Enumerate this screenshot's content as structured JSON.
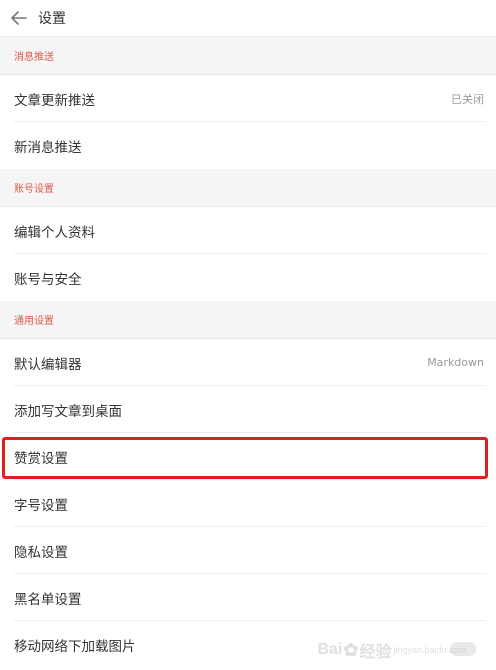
{
  "header": {
    "title": "设置"
  },
  "sections": [
    {
      "heading": "消息推送",
      "items": [
        {
          "label": "文章更新推送",
          "value": "已关闭"
        },
        {
          "label": "新消息推送"
        }
      ]
    },
    {
      "heading": "账号设置",
      "items": [
        {
          "label": "编辑个人资料"
        },
        {
          "label": "账号与安全"
        }
      ]
    },
    {
      "heading": "通用设置",
      "items": [
        {
          "label": "默认编辑器",
          "value": "Markdown"
        },
        {
          "label": "添加写文章到桌面"
        },
        {
          "label": "赞赏设置"
        },
        {
          "label": "字号设置"
        },
        {
          "label": "隐私设置"
        },
        {
          "label": "黑名单设置"
        },
        {
          "label": "移动网络下加载图片"
        }
      ]
    }
  ],
  "watermark": {
    "text": "Bai",
    "text2": "经验",
    "sub": "jingyan.baidu.com"
  },
  "colors": {
    "section_heading": "#e05a4b",
    "highlight": "#e02020"
  }
}
